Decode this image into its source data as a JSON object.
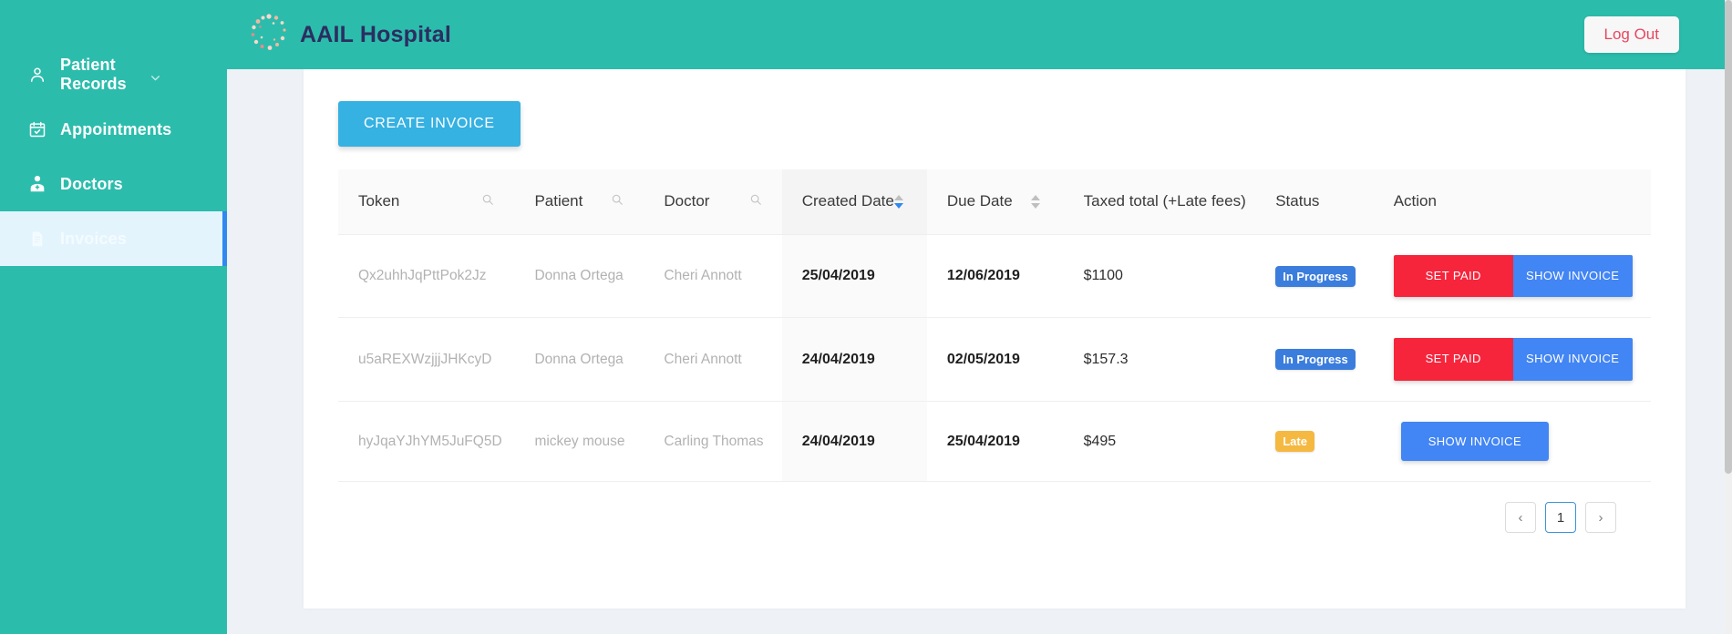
{
  "sidebar": {
    "items": [
      {
        "label": "Patient Records",
        "icon": "user-icon",
        "active": false,
        "has_chevron": true
      },
      {
        "label": "Appointments",
        "icon": "calendar-icon",
        "active": false,
        "has_chevron": false
      },
      {
        "label": "Doctors",
        "icon": "doctor-icon",
        "active": false,
        "has_chevron": false
      },
      {
        "label": "Invoices",
        "icon": "document-icon",
        "active": true,
        "has_chevron": false
      }
    ]
  },
  "topbar": {
    "brand_name": "AAIL Hospital",
    "logout_label": "Log Out"
  },
  "toolbar": {
    "create_label": "CREATE INVOICE"
  },
  "table": {
    "columns": [
      {
        "label": "Token",
        "control": "search"
      },
      {
        "label": "Patient",
        "control": "search"
      },
      {
        "label": "Doctor",
        "control": "search"
      },
      {
        "label": "Created Date",
        "control": "sort",
        "sort": "desc"
      },
      {
        "label": "Due Date",
        "control": "sort",
        "sort": "none"
      },
      {
        "label": "Taxed total (+Late fees)",
        "control": "none"
      },
      {
        "label": "Status",
        "control": "none"
      },
      {
        "label": "Action",
        "control": "none"
      }
    ],
    "rows": [
      {
        "token": "Qx2uhhJqPttPok2Jz",
        "patient": "Donna Ortega",
        "doctor": "Cheri Annott",
        "created_date": "25/04/2019",
        "due_date": "12/06/2019",
        "taxed_total": "$1100",
        "status": "In Progress",
        "status_kind": "progress",
        "actions": [
          "SET PAID",
          "SHOW INVOICE"
        ]
      },
      {
        "token": "u5aREXWzjjjJHKcyD",
        "patient": "Donna Ortega",
        "doctor": "Cheri Annott",
        "created_date": "24/04/2019",
        "due_date": "02/05/2019",
        "taxed_total": "$157.3",
        "status": "In Progress",
        "status_kind": "progress",
        "actions": [
          "SET PAID",
          "SHOW INVOICE"
        ]
      },
      {
        "token": "hyJqaYJhYM5JuFQ5D",
        "patient": "mickey mouse",
        "doctor": "Carling Thomas",
        "created_date": "24/04/2019",
        "due_date": "25/04/2019",
        "taxed_total": "$495",
        "status": "Late",
        "status_kind": "late",
        "actions": [
          "SHOW INVOICE"
        ]
      }
    ]
  },
  "pagination": {
    "prev_label": "‹",
    "next_label": "›",
    "pages": [
      "1"
    ],
    "current": "1"
  },
  "colors": {
    "sidebar": "#2cbcac",
    "topbar": "#2cbcac",
    "brand_text": "#2b2e60",
    "create_button": "#35b1e2",
    "set_paid": "#f6253c",
    "show_invoice": "#4285f4",
    "badge_progress": "#3b7ddd",
    "badge_late": "#f5b841",
    "logout_text": "#e8475f",
    "active_item_bg": "#e3f4fd",
    "active_item_border": "#2f89ef"
  }
}
